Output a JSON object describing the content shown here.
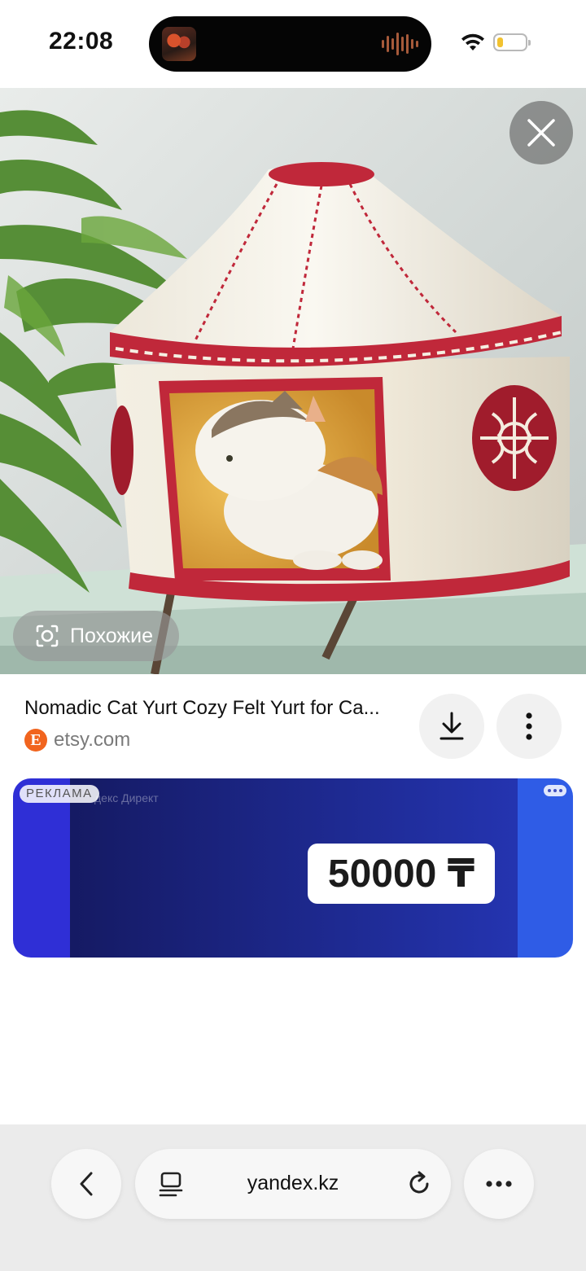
{
  "status_bar": {
    "time": "22:08",
    "icons": [
      "now-playing-album-art",
      "audio-waveform-icon",
      "wifi-icon",
      "battery-low-icon"
    ],
    "battery_color": "#f2c230"
  },
  "image_viewer": {
    "close_icon": "close-icon",
    "similar_button": {
      "label": "Похожие",
      "icon": "camera-search-icon"
    }
  },
  "result": {
    "title": "Nomadic Cat Yurt Cozy Felt Yurt for Ca...",
    "source_domain": "etsy.com",
    "source_icon_letter": "E",
    "source_icon_color": "#f1641e",
    "download_icon": "download-icon",
    "more_icon": "vertical-dots-icon"
  },
  "ad": {
    "label": "РЕКЛАМА",
    "provider": "декс Директ",
    "price": "50000 ₸",
    "accent_colors": [
      "#2f2fd6",
      "#151a63",
      "#2f5ce6"
    ]
  },
  "browser_bar": {
    "url": "yandex.kz",
    "back_icon": "back-chevron-icon",
    "tabs_icon": "tabs-icon",
    "reload_icon": "reload-icon",
    "menu_icon": "horizontal-dots-icon"
  }
}
